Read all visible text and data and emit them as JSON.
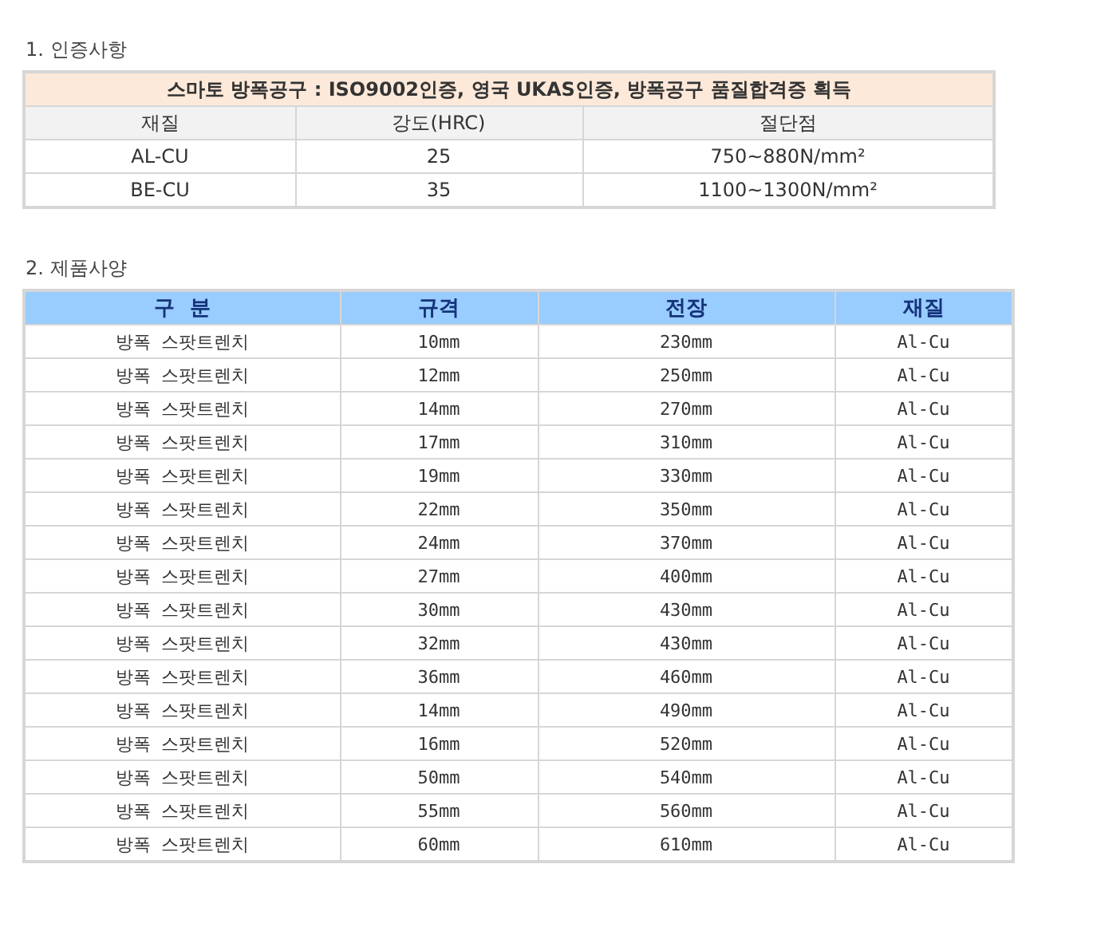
{
  "certification": {
    "title": "1. 인증사항",
    "banner": "스마토 방폭공구 : ISO9002인증, 영국 UKAS인증, 방폭공구 품질합격증 획득",
    "columns": [
      "재질",
      "강도(HRC)",
      "절단점"
    ],
    "rows": [
      [
        "AL-CU",
        "25",
        "750~880N/mm²"
      ],
      [
        "BE-CU",
        "35",
        "1100~1300N/mm²"
      ]
    ]
  },
  "specs": {
    "title": "2. 제품사양",
    "columns": [
      "구  분",
      "규격",
      "전장",
      "재질"
    ],
    "rows": [
      [
        "방폭 스팟트렌치",
        "10mm",
        "230mm",
        "Al-Cu"
      ],
      [
        "방폭 스팟트렌치",
        "12mm",
        "250mm",
        "Al-Cu"
      ],
      [
        "방폭 스팟트렌치",
        "14mm",
        "270mm",
        "Al-Cu"
      ],
      [
        "방폭 스팟트렌치",
        "17mm",
        "310mm",
        "Al-Cu"
      ],
      [
        "방폭 스팟트렌치",
        "19mm",
        "330mm",
        "Al-Cu"
      ],
      [
        "방폭 스팟트렌치",
        "22mm",
        "350mm",
        "Al-Cu"
      ],
      [
        "방폭 스팟트렌치",
        "24mm",
        "370mm",
        "Al-Cu"
      ],
      [
        "방폭 스팟트렌치",
        "27mm",
        "400mm",
        "Al-Cu"
      ],
      [
        "방폭 스팟트렌치",
        "30mm",
        "430mm",
        "Al-Cu"
      ],
      [
        "방폭 스팟트렌치",
        "32mm",
        "430mm",
        "Al-Cu"
      ],
      [
        "방폭 스팟트렌치",
        "36mm",
        "460mm",
        "Al-Cu"
      ],
      [
        "방폭 스팟트렌치",
        "14mm",
        "490mm",
        "Al-Cu"
      ],
      [
        "방폭 스팟트렌치",
        "16mm",
        "520mm",
        "Al-Cu"
      ],
      [
        "방폭 스팟트렌치",
        "50mm",
        "540mm",
        "Al-Cu"
      ],
      [
        "방폭 스팟트렌치",
        "55mm",
        "560mm",
        "Al-Cu"
      ],
      [
        "방폭 스팟트렌치",
        "60mm",
        "610mm",
        "Al-Cu"
      ]
    ]
  }
}
